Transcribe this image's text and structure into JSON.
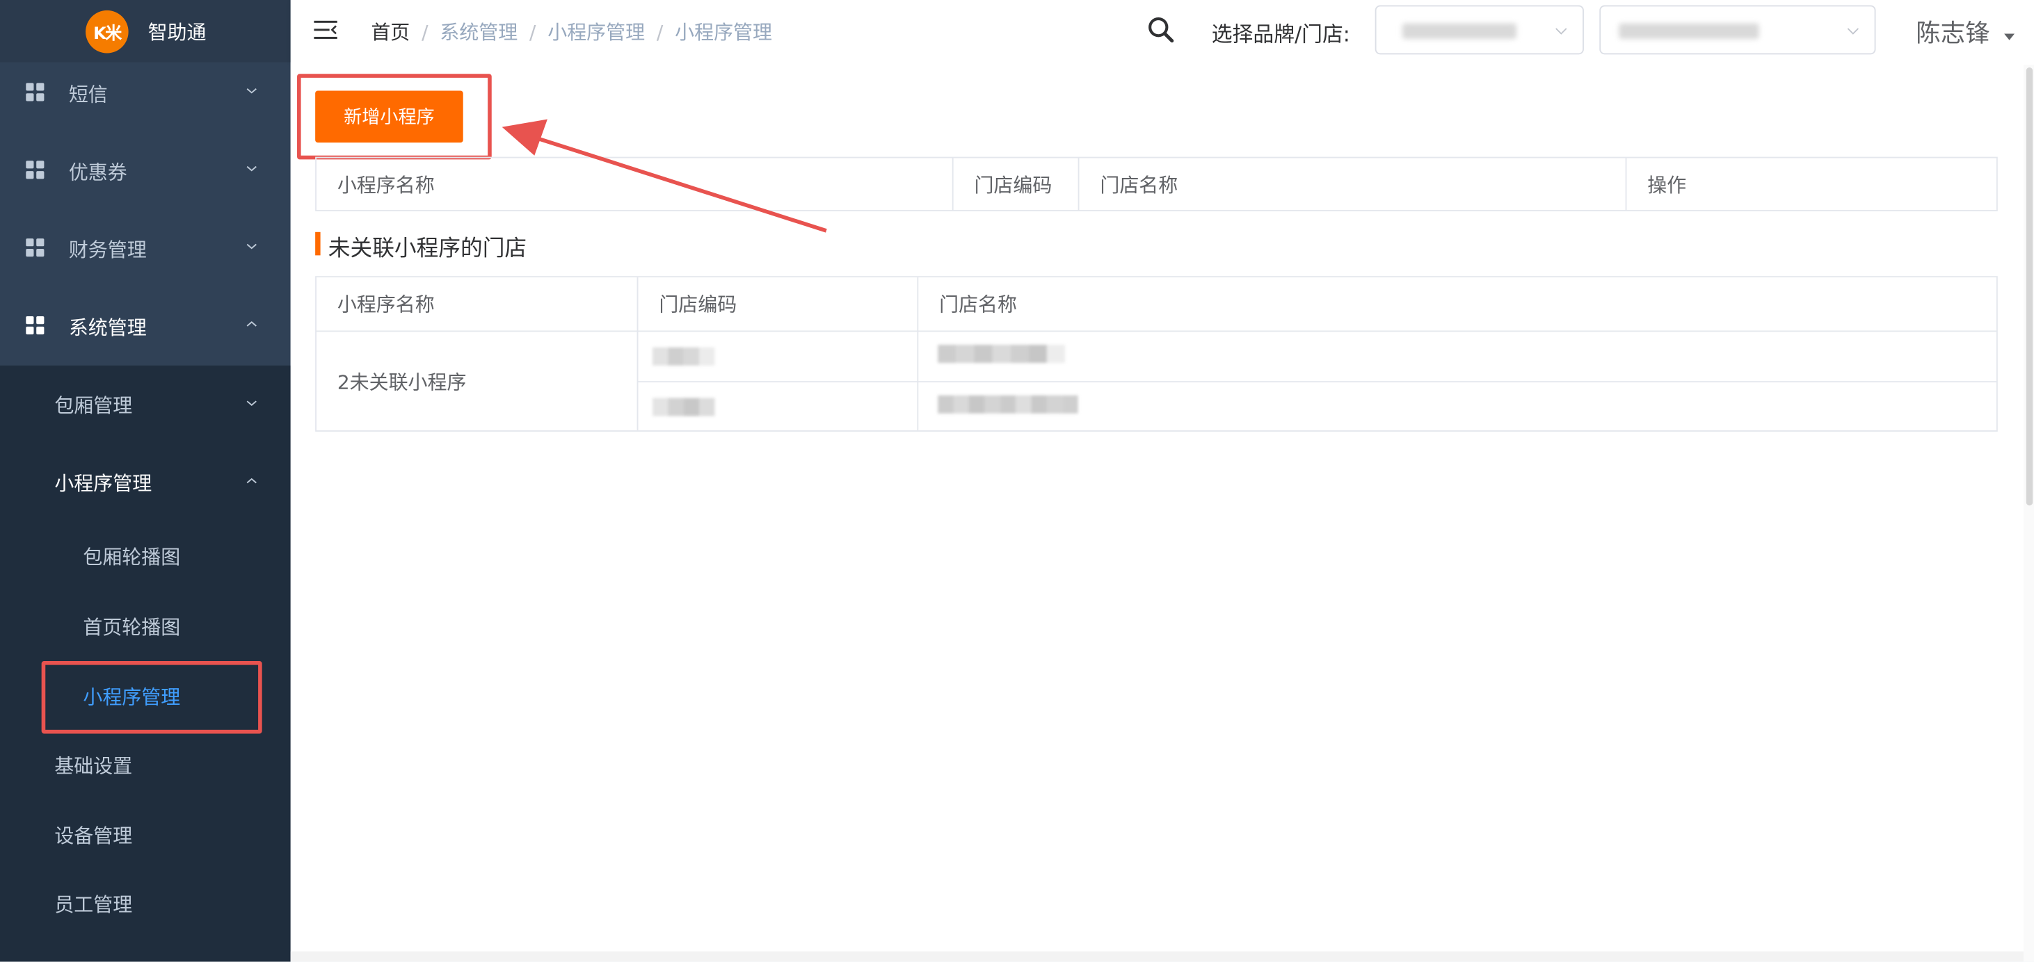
{
  "sidebar": {
    "logo_text": "K米",
    "brand_name": "智助通",
    "menu": [
      {
        "label": "短信"
      },
      {
        "label": "优惠券"
      },
      {
        "label": "财务管理"
      },
      {
        "label": "系统管理"
      }
    ],
    "submenu": [
      {
        "label": "包厢管理"
      },
      {
        "label": "小程序管理"
      },
      {
        "label": "包厢轮播图"
      },
      {
        "label": "首页轮播图"
      },
      {
        "label": "小程序管理"
      },
      {
        "label": "基础设置"
      },
      {
        "label": "设备管理"
      },
      {
        "label": "员工管理"
      }
    ]
  },
  "header": {
    "breadcrumb": [
      "首页",
      "系统管理",
      "小程序管理",
      "小程序管理"
    ],
    "store_label": "选择品牌/门店:",
    "user_name": "陈志锋"
  },
  "main": {
    "add_button": "新增小程序",
    "linked_table": {
      "headers": [
        "小程序名称",
        "门店编码",
        "门店名称",
        "操作"
      ]
    },
    "section_title": "未关联小程序的门店",
    "unlinked_table": {
      "headers": [
        "小程序名称",
        "门店编码",
        "门店名称"
      ],
      "group_name": "2未关联小程序"
    }
  },
  "colors": {
    "accent": "#ff6a00",
    "sidebar_bg": "#304156",
    "submenu_bg": "#1f2d3d",
    "active_link": "#409eff",
    "annotation_red": "#e8534f"
  },
  "icons": [
    "menu-fold-icon",
    "search-icon",
    "chevron-down-icon",
    "chevron-up-icon",
    "grid-icon",
    "caret-down-icon"
  ]
}
